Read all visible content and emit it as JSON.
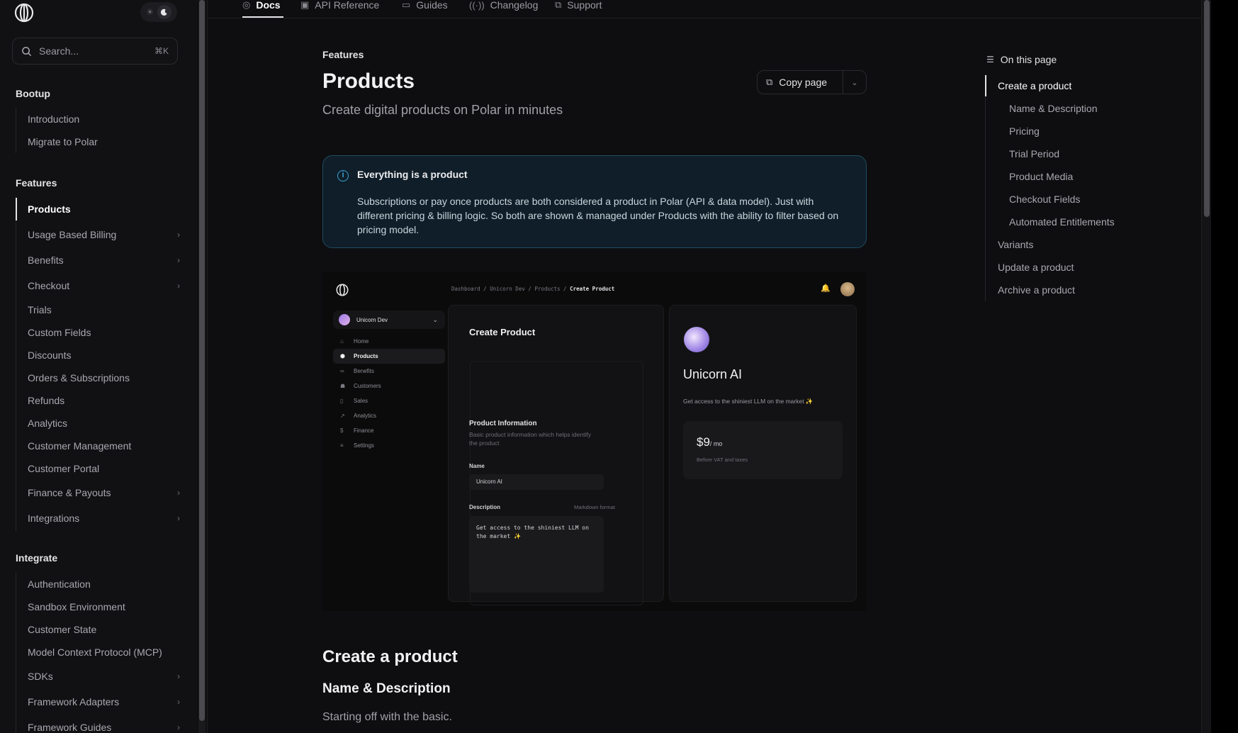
{
  "sidebar": {
    "search_placeholder": "Search...",
    "search_shortcut": "⌘K",
    "sections": [
      {
        "title": "Bootup",
        "items": [
          {
            "label": "Introduction"
          },
          {
            "label": "Migrate to Polar"
          }
        ]
      },
      {
        "title": "Features",
        "items": [
          {
            "label": "Products",
            "active": true
          },
          {
            "label": "Usage Based Billing",
            "expandable": true
          },
          {
            "label": "Benefits",
            "expandable": true
          },
          {
            "label": "Checkout",
            "expandable": true
          },
          {
            "label": "Trials"
          },
          {
            "label": "Custom Fields"
          },
          {
            "label": "Discounts"
          },
          {
            "label": "Orders & Subscriptions"
          },
          {
            "label": "Refunds"
          },
          {
            "label": "Analytics"
          },
          {
            "label": "Customer Management"
          },
          {
            "label": "Customer Portal"
          },
          {
            "label": "Finance & Payouts",
            "expandable": true
          },
          {
            "label": "Integrations",
            "expandable": true
          }
        ]
      },
      {
        "title": "Integrate",
        "items": [
          {
            "label": "Authentication"
          },
          {
            "label": "Sandbox Environment"
          },
          {
            "label": "Customer State"
          },
          {
            "label": "Model Context Protocol (MCP)"
          },
          {
            "label": "SDKs",
            "expandable": true
          },
          {
            "label": "Framework Adapters",
            "expandable": true
          },
          {
            "label": "Framework Guides",
            "expandable": true
          }
        ]
      }
    ]
  },
  "topnav": {
    "tabs": [
      {
        "label": "Docs",
        "icon": "compass-icon",
        "active": true
      },
      {
        "label": "API Reference",
        "icon": "terminal-icon"
      },
      {
        "label": "Guides",
        "icon": "book-icon"
      },
      {
        "label": "Changelog",
        "icon": "broadcast-icon"
      },
      {
        "label": "Support",
        "icon": "external-link-icon"
      }
    ]
  },
  "page": {
    "eyebrow": "Features",
    "title": "Products",
    "subtitle": "Create digital products on Polar in minutes",
    "copy_label": "Copy page",
    "callout": {
      "title": "Everything is a product",
      "body": "Subscriptions or pay once products are both considered a product in Polar (API & data model). Just with different pricing & billing logic. So both are shown & managed under Products with the ability to filter based on pricing model."
    },
    "heading_create": "Create a product",
    "heading_name": "Name & Description",
    "paragraph": "Starting off with the basic."
  },
  "screenshot": {
    "breadcrumb": [
      "Dashboard",
      "Unicorn Dev",
      "Products",
      "Create Product"
    ],
    "org_name": "Unicorn Dev",
    "nav": [
      {
        "label": "Home",
        "icon": "home-icon"
      },
      {
        "label": "Products",
        "icon": "cube-icon",
        "active": true
      },
      {
        "label": "Benefits",
        "icon": "infinity-icon"
      },
      {
        "label": "Customers",
        "icon": "users-icon"
      },
      {
        "label": "Sales",
        "icon": "bag-icon"
      },
      {
        "label": "Analytics",
        "icon": "trend-icon"
      },
      {
        "label": "Finance",
        "icon": "dollar-icon"
      },
      {
        "label": "Settings",
        "icon": "sliders-icon"
      }
    ],
    "form_title": "Create Product",
    "info_title": "Product Information",
    "info_desc": "Basic product information which helps identify the product",
    "name_label": "Name",
    "name_value": "Unicorn AI",
    "desc_label": "Description",
    "desc_hint": "Markdown format",
    "desc_value": "Get access to the shiniest LLM on the market ✨",
    "preview_name": "Unicorn AI",
    "preview_desc": "Get access to the shiniest LLM on the market ✨",
    "price": "$9",
    "price_unit": "/ mo",
    "price_note": "Before VAT and taxes"
  },
  "toc": {
    "title": "On this page",
    "items": [
      {
        "label": "Create a product",
        "active": true
      },
      {
        "label": "Name & Description",
        "sub": true
      },
      {
        "label": "Pricing",
        "sub": true
      },
      {
        "label": "Trial Period",
        "sub": true
      },
      {
        "label": "Product Media",
        "sub": true
      },
      {
        "label": "Checkout Fields",
        "sub": true
      },
      {
        "label": "Automated Entitlements",
        "sub": true
      },
      {
        "label": "Variants"
      },
      {
        "label": "Update a product"
      },
      {
        "label": "Archive a product"
      }
    ]
  }
}
